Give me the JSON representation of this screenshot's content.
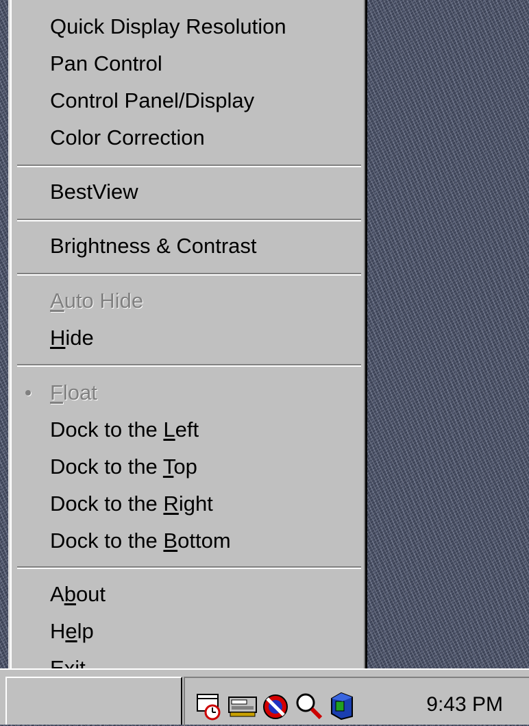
{
  "menu": {
    "items": [
      {
        "label": "Quick Display Resolution",
        "enabled": true
      },
      {
        "label": "Pan Control",
        "enabled": true
      },
      {
        "label": "Control Panel/Display",
        "enabled": true
      },
      {
        "label": "Color Correction",
        "enabled": true
      },
      {
        "label": "BestView",
        "enabled": true
      },
      {
        "label": "Brightness & Contrast",
        "enabled": true
      },
      {
        "label": "Auto Hide",
        "mnemonic": "A",
        "enabled": false
      },
      {
        "label": "Hide",
        "mnemonic": "H",
        "enabled": true
      },
      {
        "label": "Float",
        "mnemonic": "F",
        "enabled": false,
        "radio_selected": true
      },
      {
        "label": "Dock to the Left",
        "mnemonic": "L",
        "enabled": true
      },
      {
        "label": "Dock to the Top",
        "mnemonic": "T",
        "enabled": true
      },
      {
        "label": "Dock to the Right",
        "mnemonic": "R",
        "enabled": true
      },
      {
        "label": "Dock to the Bottom",
        "mnemonic": "B",
        "enabled": true
      },
      {
        "label": "About",
        "mnemonic": "b",
        "enabled": true
      },
      {
        "label": "Help",
        "mnemonic": "e",
        "enabled": true
      },
      {
        "label": "Exit",
        "mnemonic": "E",
        "enabled": true
      }
    ]
  },
  "taskbar": {
    "clock": "9:43 PM",
    "tray_icons": [
      "scheduler-icon",
      "display-card-icon",
      "no-entry-icon",
      "magnifier-icon",
      "network-cube-icon"
    ]
  },
  "colors": {
    "menu_bg": "#c0c0c0",
    "disabled_text": "#808080",
    "desktop": "#4b5266"
  }
}
